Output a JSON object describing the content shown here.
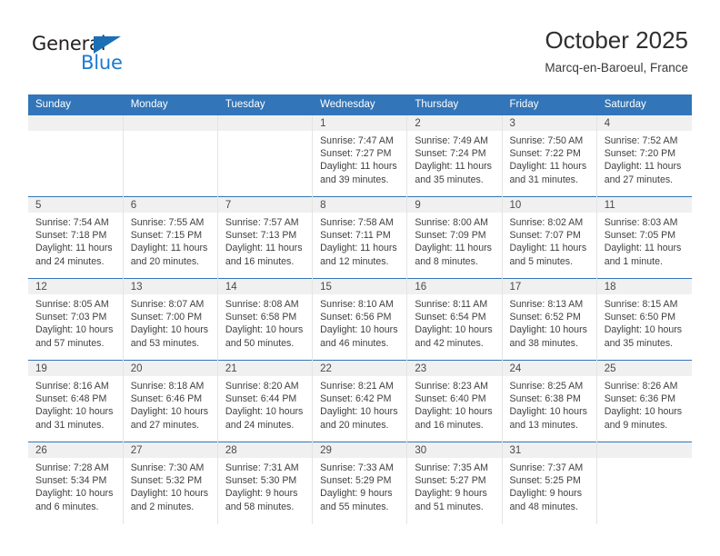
{
  "brand": {
    "name_part1": "General",
    "name_part2": "Blue",
    "triangle_color": "#1b6fb5",
    "blue_text_color": "#1b7ad0"
  },
  "header": {
    "title": "October 2025",
    "location": "Marcq-en-Baroeul, France"
  },
  "theme": {
    "header_blue": "#3275b8",
    "daynum_band": "#f0f0f0",
    "text": "#404040"
  },
  "weekday_headers": [
    "Sunday",
    "Monday",
    "Tuesday",
    "Wednesday",
    "Thursday",
    "Friday",
    "Saturday"
  ],
  "weeks": [
    [
      {
        "day": "",
        "empty": true
      },
      {
        "day": "",
        "empty": true
      },
      {
        "day": "",
        "empty": true
      },
      {
        "day": "1",
        "sunrise": "Sunrise: 7:47 AM",
        "sunset": "Sunset: 7:27 PM",
        "daylight1": "Daylight: 11 hours",
        "daylight2": "and 39 minutes."
      },
      {
        "day": "2",
        "sunrise": "Sunrise: 7:49 AM",
        "sunset": "Sunset: 7:24 PM",
        "daylight1": "Daylight: 11 hours",
        "daylight2": "and 35 minutes."
      },
      {
        "day": "3",
        "sunrise": "Sunrise: 7:50 AM",
        "sunset": "Sunset: 7:22 PM",
        "daylight1": "Daylight: 11 hours",
        "daylight2": "and 31 minutes."
      },
      {
        "day": "4",
        "sunrise": "Sunrise: 7:52 AM",
        "sunset": "Sunset: 7:20 PM",
        "daylight1": "Daylight: 11 hours",
        "daylight2": "and 27 minutes."
      }
    ],
    [
      {
        "day": "5",
        "sunrise": "Sunrise: 7:54 AM",
        "sunset": "Sunset: 7:18 PM",
        "daylight1": "Daylight: 11 hours",
        "daylight2": "and 24 minutes."
      },
      {
        "day": "6",
        "sunrise": "Sunrise: 7:55 AM",
        "sunset": "Sunset: 7:15 PM",
        "daylight1": "Daylight: 11 hours",
        "daylight2": "and 20 minutes."
      },
      {
        "day": "7",
        "sunrise": "Sunrise: 7:57 AM",
        "sunset": "Sunset: 7:13 PM",
        "daylight1": "Daylight: 11 hours",
        "daylight2": "and 16 minutes."
      },
      {
        "day": "8",
        "sunrise": "Sunrise: 7:58 AM",
        "sunset": "Sunset: 7:11 PM",
        "daylight1": "Daylight: 11 hours",
        "daylight2": "and 12 minutes."
      },
      {
        "day": "9",
        "sunrise": "Sunrise: 8:00 AM",
        "sunset": "Sunset: 7:09 PM",
        "daylight1": "Daylight: 11 hours",
        "daylight2": "and 8 minutes."
      },
      {
        "day": "10",
        "sunrise": "Sunrise: 8:02 AM",
        "sunset": "Sunset: 7:07 PM",
        "daylight1": "Daylight: 11 hours",
        "daylight2": "and 5 minutes."
      },
      {
        "day": "11",
        "sunrise": "Sunrise: 8:03 AM",
        "sunset": "Sunset: 7:05 PM",
        "daylight1": "Daylight: 11 hours",
        "daylight2": "and 1 minute."
      }
    ],
    [
      {
        "day": "12",
        "sunrise": "Sunrise: 8:05 AM",
        "sunset": "Sunset: 7:03 PM",
        "daylight1": "Daylight: 10 hours",
        "daylight2": "and 57 minutes."
      },
      {
        "day": "13",
        "sunrise": "Sunrise: 8:07 AM",
        "sunset": "Sunset: 7:00 PM",
        "daylight1": "Daylight: 10 hours",
        "daylight2": "and 53 minutes."
      },
      {
        "day": "14",
        "sunrise": "Sunrise: 8:08 AM",
        "sunset": "Sunset: 6:58 PM",
        "daylight1": "Daylight: 10 hours",
        "daylight2": "and 50 minutes."
      },
      {
        "day": "15",
        "sunrise": "Sunrise: 8:10 AM",
        "sunset": "Sunset: 6:56 PM",
        "daylight1": "Daylight: 10 hours",
        "daylight2": "and 46 minutes."
      },
      {
        "day": "16",
        "sunrise": "Sunrise: 8:11 AM",
        "sunset": "Sunset: 6:54 PM",
        "daylight1": "Daylight: 10 hours",
        "daylight2": "and 42 minutes."
      },
      {
        "day": "17",
        "sunrise": "Sunrise: 8:13 AM",
        "sunset": "Sunset: 6:52 PM",
        "daylight1": "Daylight: 10 hours",
        "daylight2": "and 38 minutes."
      },
      {
        "day": "18",
        "sunrise": "Sunrise: 8:15 AM",
        "sunset": "Sunset: 6:50 PM",
        "daylight1": "Daylight: 10 hours",
        "daylight2": "and 35 minutes."
      }
    ],
    [
      {
        "day": "19",
        "sunrise": "Sunrise: 8:16 AM",
        "sunset": "Sunset: 6:48 PM",
        "daylight1": "Daylight: 10 hours",
        "daylight2": "and 31 minutes."
      },
      {
        "day": "20",
        "sunrise": "Sunrise: 8:18 AM",
        "sunset": "Sunset: 6:46 PM",
        "daylight1": "Daylight: 10 hours",
        "daylight2": "and 27 minutes."
      },
      {
        "day": "21",
        "sunrise": "Sunrise: 8:20 AM",
        "sunset": "Sunset: 6:44 PM",
        "daylight1": "Daylight: 10 hours",
        "daylight2": "and 24 minutes."
      },
      {
        "day": "22",
        "sunrise": "Sunrise: 8:21 AM",
        "sunset": "Sunset: 6:42 PM",
        "daylight1": "Daylight: 10 hours",
        "daylight2": "and 20 minutes."
      },
      {
        "day": "23",
        "sunrise": "Sunrise: 8:23 AM",
        "sunset": "Sunset: 6:40 PM",
        "daylight1": "Daylight: 10 hours",
        "daylight2": "and 16 minutes."
      },
      {
        "day": "24",
        "sunrise": "Sunrise: 8:25 AM",
        "sunset": "Sunset: 6:38 PM",
        "daylight1": "Daylight: 10 hours",
        "daylight2": "and 13 minutes."
      },
      {
        "day": "25",
        "sunrise": "Sunrise: 8:26 AM",
        "sunset": "Sunset: 6:36 PM",
        "daylight1": "Daylight: 10 hours",
        "daylight2": "and 9 minutes."
      }
    ],
    [
      {
        "day": "26",
        "sunrise": "Sunrise: 7:28 AM",
        "sunset": "Sunset: 5:34 PM",
        "daylight1": "Daylight: 10 hours",
        "daylight2": "and 6 minutes."
      },
      {
        "day": "27",
        "sunrise": "Sunrise: 7:30 AM",
        "sunset": "Sunset: 5:32 PM",
        "daylight1": "Daylight: 10 hours",
        "daylight2": "and 2 minutes."
      },
      {
        "day": "28",
        "sunrise": "Sunrise: 7:31 AM",
        "sunset": "Sunset: 5:30 PM",
        "daylight1": "Daylight: 9 hours",
        "daylight2": "and 58 minutes."
      },
      {
        "day": "29",
        "sunrise": "Sunrise: 7:33 AM",
        "sunset": "Sunset: 5:29 PM",
        "daylight1": "Daylight: 9 hours",
        "daylight2": "and 55 minutes."
      },
      {
        "day": "30",
        "sunrise": "Sunrise: 7:35 AM",
        "sunset": "Sunset: 5:27 PM",
        "daylight1": "Daylight: 9 hours",
        "daylight2": "and 51 minutes."
      },
      {
        "day": "31",
        "sunrise": "Sunrise: 7:37 AM",
        "sunset": "Sunset: 5:25 PM",
        "daylight1": "Daylight: 9 hours",
        "daylight2": "and 48 minutes."
      },
      {
        "day": "",
        "empty": true
      }
    ]
  ]
}
